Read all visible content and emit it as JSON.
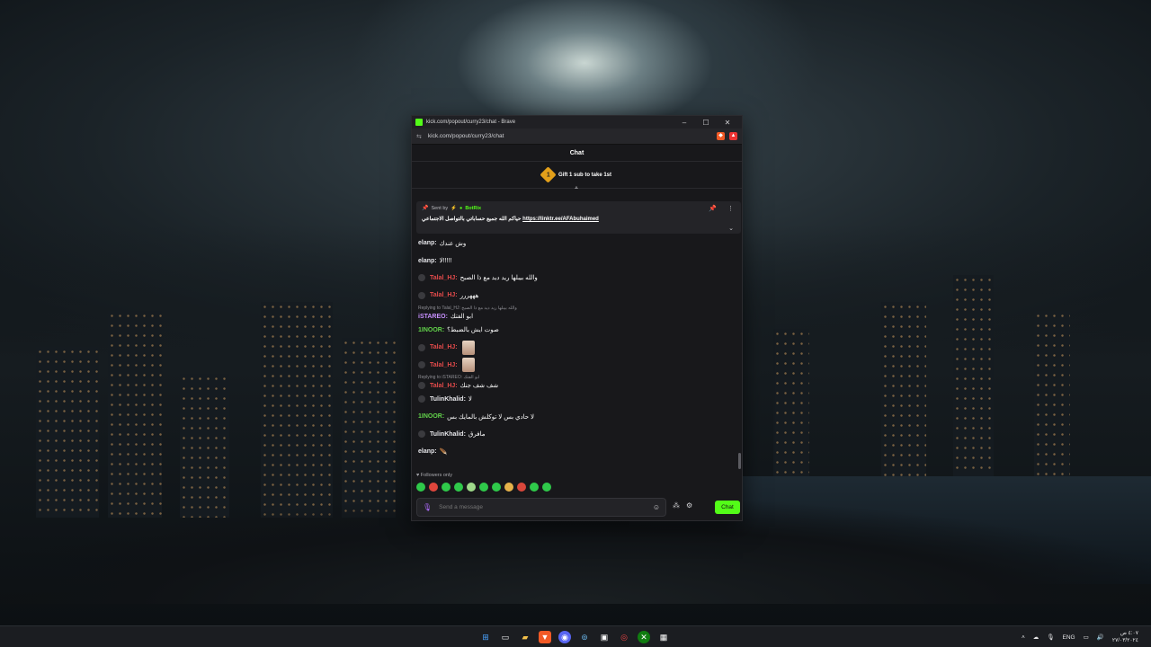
{
  "browser": {
    "title": "kick.com/popout/curry23/chat - Brave",
    "url": "kick.com/popout/curry23/chat",
    "controls": {
      "minimize": "–",
      "maximize": "☐",
      "close": "✕"
    }
  },
  "chat": {
    "header": "Chat",
    "gift": {
      "rank": "1",
      "text": "Gift 1 sub to take 1st"
    },
    "pinned": {
      "sent_by_label": "Sent by",
      "bot_name": "BotRix",
      "message_prefix": "حياكم الله جميع حساباتي بالتواصل الاجتماعي",
      "link": "https://linktr.ee/AFAbuhaimed"
    },
    "messages": [
      {
        "user": "elanp:",
        "text": "وش عندك"
      },
      {
        "user": "elanp:",
        "text": "لا!!!!!"
      },
      {
        "user": "Talal_HJ:",
        "text": "والله بيبلها ريد ديد مع ذا الصبح"
      },
      {
        "user": "Talal_HJ:",
        "text": "هههررر"
      },
      {
        "reply": "Replying to Talal_HJ: والله بيبلها ريد ديد مع ذا الصبح"
      },
      {
        "user": "iSTAREO:",
        "text": "ابو الفتك"
      },
      {
        "user": "1INOOR:",
        "text": "صوت ايش بالضبط؟"
      },
      {
        "user": "Talal_HJ:",
        "text": ""
      },
      {
        "user": "Talal_HJ:",
        "text": ""
      },
      {
        "reply": "Replying to iSTAREO: ابو الفتك"
      },
      {
        "user": "Talal_HJ:",
        "text": "شف شف جنك"
      },
      {
        "user": "TulinKhalid:",
        "text": "لا"
      },
      {
        "user": "1INOOR:",
        "text": "لا حادي بس لا توكلش بالمايك بس"
      },
      {
        "user": "TulinKhalid:",
        "text": "مافرق"
      },
      {
        "user": "elanp:",
        "text": "🪶"
      }
    ],
    "followers_only": "Followers only",
    "input_placeholder": "Send a message",
    "send_button": "Chat"
  },
  "taskbar": {
    "language": "ENG",
    "time": "٤:٠٧ ص",
    "date": "٢٧/٠٣/٢٠٢٤"
  },
  "colors": {
    "kick_green": "#53fc18",
    "user_green": "#62d24a",
    "user_red": "#e44b4b",
    "user_purple": "#c890ff"
  }
}
